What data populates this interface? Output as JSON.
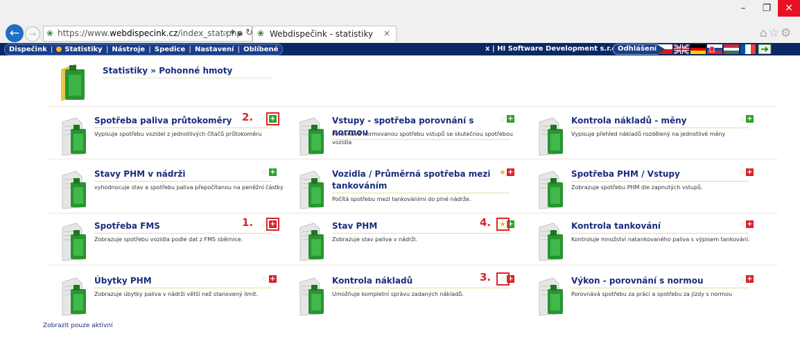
{
  "browser": {
    "url_prefix": "https://www.",
    "url_domain": "webdispecink.cz",
    "url_path": "/index_stat.php",
    "tab_title": "Webdispečink - statistiky",
    "window_controls": [
      "–",
      "❐",
      "✕"
    ]
  },
  "menu": {
    "items": [
      "Dispečink",
      "Statistiky",
      "Nástroje",
      "Spedice",
      "Nastavení",
      "Oblíbené"
    ],
    "separator": "|",
    "close_x": "x",
    "company": "| HI Software Development s.r.o.",
    "logout": "Odhlášení",
    "flags": [
      "cz",
      "gb",
      "de",
      "sk",
      "hu",
      "fr",
      "export"
    ]
  },
  "page": {
    "title": "Statistiky » Pohonné hmoty"
  },
  "cards": [
    {
      "title": "Spotřeba paliva průtokoměry",
      "desc": "Vypisuje spotřebu vozidel z jednotlivých čítačů průtokoměru",
      "starred": false,
      "action": "plus",
      "marker": "2."
    },
    {
      "title": "Vstupy - spotřeba porovnání s normou",
      "desc": "Porovnává normovanou spotřebu vstupů se skutečnou spotřebou vozidla",
      "starred": false,
      "action": "plus",
      "marker": ""
    },
    {
      "title": "Kontrola nákladů - měny",
      "desc": "Vypisuje přehled nákladů rozdělený na jednotlivé měny",
      "starred": false,
      "action": "plus",
      "marker": ""
    },
    {
      "title": "Stavy PHM v nádrži",
      "desc": "vyhodnocuje stav a spotřebu paliva přepočítanou na peněžní částky",
      "starred": false,
      "action": "plus",
      "marker": ""
    },
    {
      "title": "Vozidla / Průměrná spotřeba mezi tankováním",
      "desc": "Počítá spotřebu mezi tankováními do plné nádrže.",
      "starred": true,
      "action": "minus",
      "marker": ""
    },
    {
      "title": "Spotřeba PHM / Vstupy",
      "desc": "Zobrazuje spotřebu PHM dle zapnutých vstupů.",
      "starred": false,
      "action": "minus",
      "marker": ""
    },
    {
      "title": "Spotřeba FMS",
      "desc": "Zobrazuje spotřebu vozidla podle dat z FMS sběrnice.",
      "starred": false,
      "action": "minus",
      "marker": "1."
    },
    {
      "title": "Stav PHM",
      "desc": "Zobrazuje stav paliva v nádrži.",
      "starred": true,
      "action": "plus",
      "marker": "4."
    },
    {
      "title": "Kontrola tankování",
      "desc": "Kontroluje množství natankovaného paliva s výpisem tankování.",
      "starred": false,
      "action": "minus",
      "marker": ""
    },
    {
      "title": "Úbytky PHM",
      "desc": "Zobrazuje úbytky paliva v nádrži větší než stanovený limit.",
      "starred": false,
      "action": "minus",
      "marker": ""
    },
    {
      "title": "Kontrola nákladů",
      "desc": "Umožňuje kompletní správu zadaných nákladů.",
      "starred": false,
      "action": "minus",
      "marker": "3."
    },
    {
      "title": "Výkon - porovnání s normou",
      "desc": "Porovnává spotřebu za práci a spotřebu za jízdy s normou",
      "starred": false,
      "action": "minus",
      "marker": ""
    }
  ],
  "footer": {
    "link": "Zobrazit pouze aktivní"
  },
  "colors": {
    "menu_bg": "#0a2864",
    "title_blue": "#1a2d7d",
    "annotation_red": "#d9262a",
    "star_active": "#e9b531"
  }
}
